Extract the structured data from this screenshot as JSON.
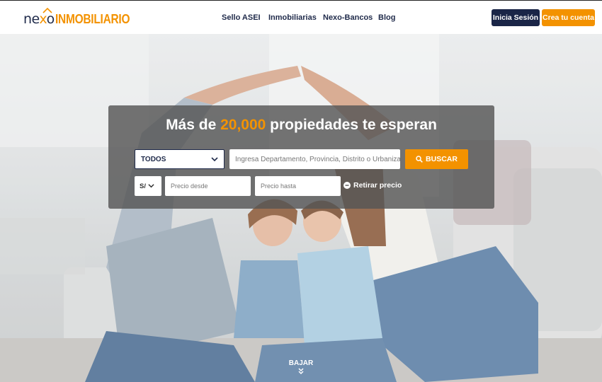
{
  "brand": {
    "logo_part1": "nexo",
    "logo_part2": "INMOBILIARIO"
  },
  "nav": {
    "links": [
      "Sello ASEI",
      "Inmobiliarias",
      "Nexo-Bancos",
      "Blog"
    ],
    "login_label": "Inicia Sesión",
    "signup_label": "Crea tu cuenta"
  },
  "hero": {
    "headline_pre": "Más de ",
    "headline_highlight": "20,000",
    "headline_post": " propiedades te esperan",
    "scroll_label": "BAJAR"
  },
  "search": {
    "type_value": "TODOS",
    "location_placeholder": "Ingresa Departamento, Provincia, Distrito o Urbanización",
    "search_label": "BUSCAR",
    "currency_value": "S/",
    "price_from_placeholder": "Precio desde",
    "price_to_placeholder": "Precio hasta",
    "remove_price_label": "Retirar precio"
  },
  "colors": {
    "brand_orange": "#f39200",
    "brand_navy": "#1a2547"
  }
}
